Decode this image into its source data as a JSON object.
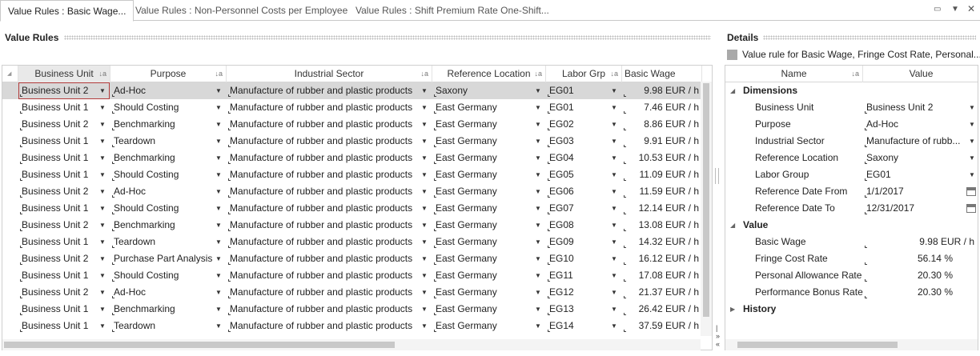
{
  "tabs": [
    {
      "label": "Value Rules : Basic Wage..."
    },
    {
      "label": "Value Rules : Non-Personnel Costs per Employee"
    },
    {
      "label": "Value Rules : Shift Premium Rate One-Shift..."
    }
  ],
  "value_rules": {
    "title": "Value Rules",
    "columns": [
      "Business Unit",
      "Purpose",
      "Industrial Sector",
      "Reference Location",
      "Labor Grp",
      "Basic Wage"
    ],
    "rows": [
      {
        "bu": "Business Unit 2",
        "purpose": "Ad-Hoc",
        "sector": "Manufacture of rubber and plastic products",
        "loc": "Saxony",
        "grp": "EG01",
        "wage": "9.98 EUR / h"
      },
      {
        "bu": "Business Unit 1",
        "purpose": "Should Costing",
        "sector": "Manufacture of rubber and plastic products",
        "loc": "East Germany",
        "grp": "EG01",
        "wage": "7.46 EUR / h"
      },
      {
        "bu": "Business Unit 2",
        "purpose": "Benchmarking",
        "sector": "Manufacture of rubber and plastic products",
        "loc": "East Germany",
        "grp": "EG02",
        "wage": "8.86 EUR / h"
      },
      {
        "bu": "Business Unit 1",
        "purpose": "Teardown",
        "sector": "Manufacture of rubber and plastic products",
        "loc": "East Germany",
        "grp": "EG03",
        "wage": "9.91 EUR / h"
      },
      {
        "bu": "Business Unit 1",
        "purpose": "Benchmarking",
        "sector": "Manufacture of rubber and plastic products",
        "loc": "East Germany",
        "grp": "EG04",
        "wage": "10.53 EUR / h"
      },
      {
        "bu": "Business Unit 1",
        "purpose": "Should Costing",
        "sector": "Manufacture of rubber and plastic products",
        "loc": "East Germany",
        "grp": "EG05",
        "wage": "11.09 EUR / h"
      },
      {
        "bu": "Business Unit 2",
        "purpose": "Ad-Hoc",
        "sector": "Manufacture of rubber and plastic products",
        "loc": "East Germany",
        "grp": "EG06",
        "wage": "11.59 EUR / h"
      },
      {
        "bu": "Business Unit 1",
        "purpose": "Should Costing",
        "sector": "Manufacture of rubber and plastic products",
        "loc": "East Germany",
        "grp": "EG07",
        "wage": "12.14 EUR / h"
      },
      {
        "bu": "Business Unit 2",
        "purpose": "Benchmarking",
        "sector": "Manufacture of rubber and plastic products",
        "loc": "East Germany",
        "grp": "EG08",
        "wage": "13.08 EUR / h"
      },
      {
        "bu": "Business Unit 1",
        "purpose": "Teardown",
        "sector": "Manufacture of rubber and plastic products",
        "loc": "East Germany",
        "grp": "EG09",
        "wage": "14.32 EUR / h"
      },
      {
        "bu": "Business Unit 2",
        "purpose": "Purchase Part Analysis",
        "sector": "Manufacture of rubber and plastic products",
        "loc": "East Germany",
        "grp": "EG10",
        "wage": "16.12 EUR / h"
      },
      {
        "bu": "Business Unit 1",
        "purpose": "Should Costing",
        "sector": "Manufacture of rubber and plastic products",
        "loc": "East Germany",
        "grp": "EG11",
        "wage": "17.08 EUR / h"
      },
      {
        "bu": "Business Unit 2",
        "purpose": "Ad-Hoc",
        "sector": "Manufacture of rubber and plastic products",
        "loc": "East Germany",
        "grp": "EG12",
        "wage": "21.37 EUR / h"
      },
      {
        "bu": "Business Unit 1",
        "purpose": "Benchmarking",
        "sector": "Manufacture of rubber and plastic products",
        "loc": "East Germany",
        "grp": "EG13",
        "wage": "26.42 EUR / h"
      },
      {
        "bu": "Business Unit 1",
        "purpose": "Teardown",
        "sector": "Manufacture of rubber and plastic products",
        "loc": "East Germany",
        "grp": "EG14",
        "wage": "37.59 EUR / h"
      }
    ]
  },
  "details": {
    "title": "Details",
    "caption": "Value rule for Basic Wage, Fringe Cost Rate, Personal...",
    "columns": [
      "Name",
      "Value"
    ],
    "categories": {
      "dimensions": "Dimensions",
      "value": "Value",
      "history": "History"
    },
    "dimensions": [
      {
        "name": "Business Unit",
        "value": "Business Unit 2"
      },
      {
        "name": "Purpose",
        "value": "Ad-Hoc"
      },
      {
        "name": "Industrial Sector",
        "value": "Manufacture of rubb..."
      },
      {
        "name": "Reference Location",
        "value": "Saxony"
      },
      {
        "name": "Labor Group",
        "value": "EG01"
      },
      {
        "name": "Reference Date From",
        "value": "1/1/2017"
      },
      {
        "name": "Reference Date To",
        "value": "12/31/2017"
      }
    ],
    "values": [
      {
        "name": "Basic Wage",
        "value": "9.98 EUR / h"
      },
      {
        "name": "Fringe Cost Rate",
        "value": "56.14 %"
      },
      {
        "name": "Personal Allowance Rate",
        "value": "20.30 %"
      },
      {
        "name": "Performance Bonus Rate",
        "value": "20.30 %"
      }
    ]
  },
  "icons": {
    "sort": "sort-icon",
    "dropdown": "chevron-down-icon",
    "calendar": "calendar-icon"
  }
}
